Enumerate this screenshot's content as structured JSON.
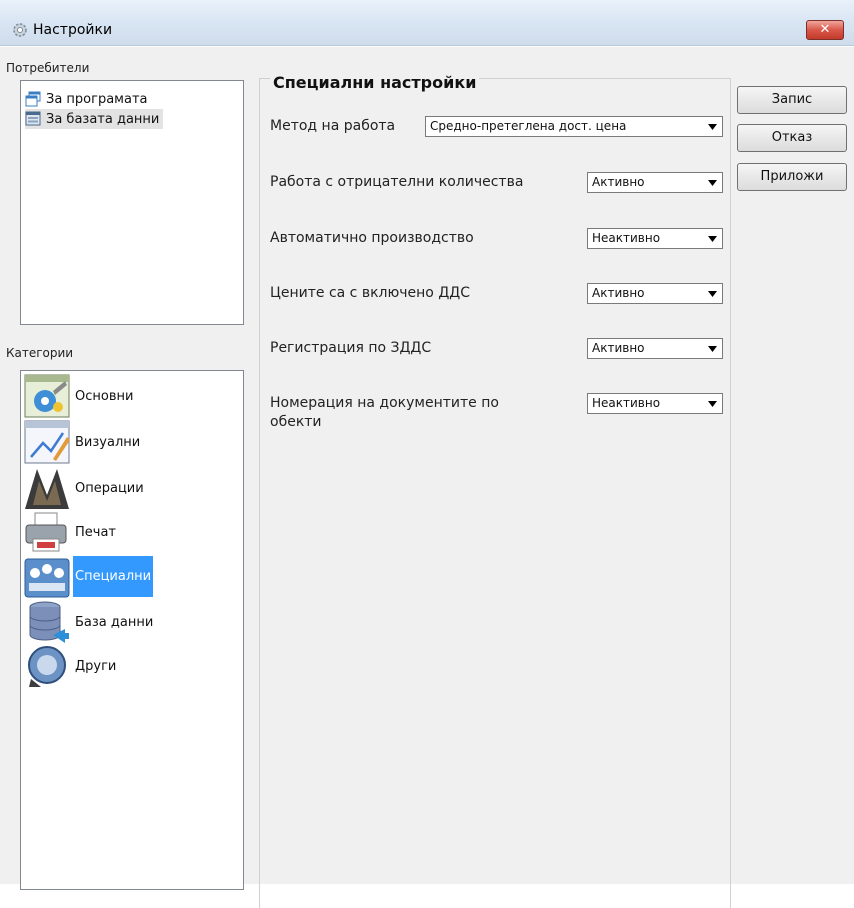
{
  "window": {
    "title": "Настройки",
    "close_glyph": "✕"
  },
  "users_panel": {
    "label": "Потребители",
    "items": [
      {
        "label": "За програмата",
        "icon": "windows-app-icon"
      },
      {
        "label": "За базата данни",
        "icon": "database-window-icon"
      }
    ]
  },
  "categories_panel": {
    "label": "Категории",
    "items": [
      {
        "label": "Основни",
        "icon": "basic-settings-icon"
      },
      {
        "label": "Визуални",
        "icon": "visual-settings-icon"
      },
      {
        "label": "Операции",
        "icon": "operations-icon"
      },
      {
        "label": "Печат",
        "icon": "printer-icon"
      },
      {
        "label": "Специални",
        "icon": "special-settings-icon",
        "selected": true
      },
      {
        "label": "База данни",
        "icon": "database-icon"
      },
      {
        "label": "Други",
        "icon": "other-settings-icon"
      }
    ]
  },
  "special_settings": {
    "title": "Специални настройки",
    "method": {
      "label": "Метод на работа",
      "value": "Средно-претеглена дост. цена"
    },
    "rows": [
      {
        "label": "Работа с отрицателни количества",
        "value": "Активно"
      },
      {
        "label": "Автоматично производство",
        "value": "Неактивно"
      },
      {
        "label": "Цените са с включено ДДС",
        "value": "Активно"
      },
      {
        "label": "Регистрация по ЗДДС",
        "value": "Активно"
      },
      {
        "label": "Номерация на документите по",
        "label_line2": "обекти",
        "value": "Неактивно"
      }
    ]
  },
  "buttons": {
    "save": "Запис",
    "cancel": "Отказ",
    "apply": "Приложи"
  },
  "colors": {
    "selection": "#3399ff",
    "titlebar": "#d7e4f2",
    "close": "#c23a2a"
  }
}
